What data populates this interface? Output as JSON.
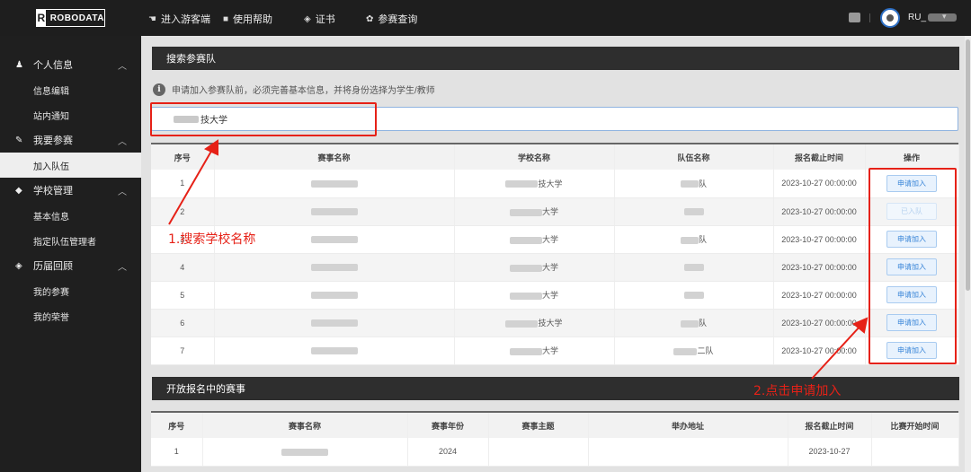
{
  "brand": {
    "mark": "R",
    "name": "ROBODATA"
  },
  "topnav": [
    {
      "icon": "hand-pointer-icon",
      "glyph": "☚",
      "label": "进入游客端"
    },
    {
      "icon": "book-icon",
      "glyph": "■",
      "label": "使用帮助"
    },
    {
      "icon": "certificate-icon",
      "glyph": "◈",
      "label": "证书"
    },
    {
      "icon": "gear-icon",
      "glyph": "✿",
      "label": "参赛查询"
    }
  ],
  "user": {
    "name": "RU_"
  },
  "sidebar": {
    "groups": [
      {
        "icon": "user-icon",
        "glyph": "♟",
        "label": "个人信息",
        "chevron": "︿",
        "items": [
          "信息编辑",
          "站内通知"
        ]
      },
      {
        "icon": "edit-icon",
        "glyph": "✎",
        "label": "我要参赛",
        "chevron": "︿",
        "items": [
          "加入队伍"
        ]
      },
      {
        "icon": "graduation-cap-icon",
        "glyph": "◆",
        "label": "学校管理",
        "chevron": "︿",
        "items": [
          "基本信息",
          "指定队伍管理者"
        ]
      },
      {
        "icon": "cube-icon",
        "glyph": "◈",
        "label": "历届回顾",
        "chevron": "︿",
        "items": [
          "我的参赛",
          "我的荣誉"
        ]
      }
    ],
    "active_item": "加入队伍"
  },
  "search_panel": {
    "title": "搜索参赛队",
    "notice": "申请加入参赛队前，必须完善基本信息，并将身份选择为学生/教师",
    "search_value": "技大学"
  },
  "teams_table": {
    "headers": [
      "序号",
      "赛事名称",
      "学校名称",
      "队伍名称",
      "报名截止时间",
      "操作"
    ],
    "rows": [
      {
        "no": "1",
        "school": "技大学",
        "team": "队",
        "deadline": "2023-10-27 00:00:00",
        "action": "申请加入",
        "disabled": false
      },
      {
        "no": "2",
        "school": "大学",
        "team": "",
        "deadline": "2023-10-27 00:00:00",
        "action": "已入队",
        "disabled": true
      },
      {
        "no": "3",
        "school": "大学",
        "team": "队",
        "deadline": "2023-10-27 00:00:00",
        "action": "申请加入",
        "disabled": false
      },
      {
        "no": "4",
        "school": "大学",
        "team": "",
        "deadline": "2023-10-27 00:00:00",
        "action": "申请加入",
        "disabled": false
      },
      {
        "no": "5",
        "school": "大学",
        "team": "",
        "deadline": "2023-10-27 00:00:00",
        "action": "申请加入",
        "disabled": false
      },
      {
        "no": "6",
        "school": "技大学",
        "team": "队",
        "deadline": "2023-10-27 00:00:00",
        "action": "申请加入",
        "disabled": false
      },
      {
        "no": "7",
        "school": "大学",
        "team": "二队",
        "deadline": "2023-10-27 00:00:00",
        "action": "申请加入",
        "disabled": false
      }
    ]
  },
  "open_panel": {
    "title": "开放报名中的赛事",
    "headers": [
      "序号",
      "赛事名称",
      "赛事年份",
      "赛事主题",
      "举办地址",
      "报名截止时间",
      "比赛开始时间"
    ],
    "rows": [
      {
        "no": "1",
        "year": "2024",
        "deadline": "2023-10-27"
      }
    ]
  },
  "annotations": {
    "step1": "1.搜索学校名称",
    "step2": "2.点击申请加入",
    "color": "#e62117"
  }
}
